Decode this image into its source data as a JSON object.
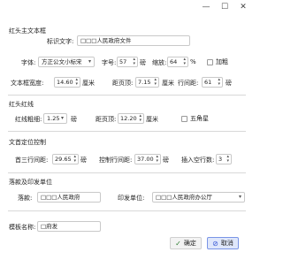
{
  "window": {
    "minimize": "—",
    "maximize": "☐",
    "close": "✕"
  },
  "sections": {
    "main_text": "红头主文本框",
    "red_line": "红头红线",
    "position": "文首定位控制",
    "signature": "落款及印发单位"
  },
  "main_text": {
    "label_text": "标识文字:",
    "value_text": "□□□人民政府文件",
    "label_font": "字体:",
    "value_font": "方正公文小标宋",
    "label_size": "字号:",
    "value_size": "57",
    "unit_size": "磅",
    "label_scale": "缩放:",
    "value_scale": "64",
    "unit_scale": "%",
    "bold_label": "加粗",
    "label_width": "文本框宽度:",
    "value_width": "14.60",
    "unit_width": "厘米",
    "label_top": "距页顶:",
    "value_top": "7.15",
    "unit_top": "厘米",
    "label_spacing": "行间距:",
    "value_spacing": "61",
    "unit_spacing": "磅"
  },
  "red_line": {
    "label_thickness": "红线粗细:",
    "value_thickness": "1.25",
    "unit_thickness": "磅",
    "label_top": "距页顶:",
    "value_top": "12.20",
    "unit_top": "厘米",
    "star_label": "五角星"
  },
  "position": {
    "label_first": "首三行间距:",
    "value_first": "29.65",
    "unit_first": "磅",
    "label_ctrl": "控制行间距:",
    "value_ctrl": "37.00",
    "unit_ctrl": "磅",
    "label_blank": "插入空行数:",
    "value_blank": "3"
  },
  "signature": {
    "label_sign": "落款:",
    "value_sign": "□□□人民政府",
    "label_unit": "印发单位:",
    "value_unit": "□□□人民政府办公厅"
  },
  "template": {
    "label": "模板名称:",
    "value": "□府发"
  },
  "buttons": {
    "ok": "确定",
    "cancel": "取消"
  },
  "colors": {
    "accent": "#dfe7fb",
    "accent_border": "#7a95e6",
    "divider": "#d8d8d8"
  }
}
